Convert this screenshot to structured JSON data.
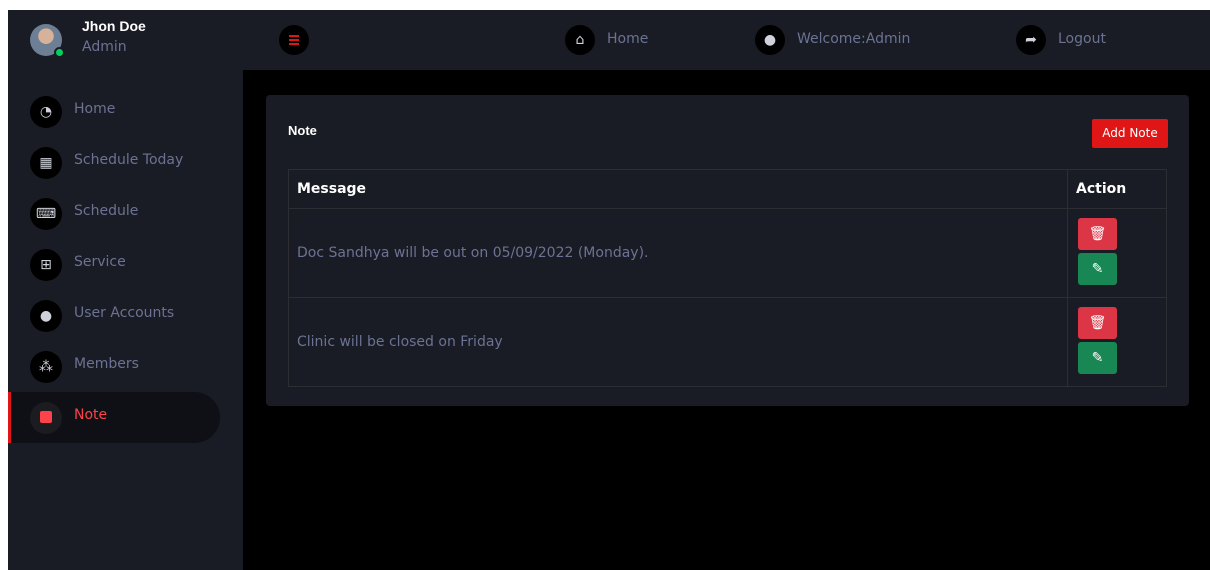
{
  "profile": {
    "name": "Jhon Doe",
    "role": "Admin"
  },
  "sidebar": {
    "items": [
      {
        "label": "Home",
        "icon": "dashboard-icon",
        "glyph": "◔",
        "active": false
      },
      {
        "label": "Schedule Today",
        "icon": "grid-icon",
        "glyph": "▦",
        "active": false
      },
      {
        "label": "Schedule",
        "icon": "keyboard-icon",
        "glyph": "⌨",
        "active": false
      },
      {
        "label": "Service",
        "icon": "table-icon",
        "glyph": "⊞",
        "active": false
      },
      {
        "label": "User Accounts",
        "icon": "user-icon",
        "glyph": "●",
        "active": false
      },
      {
        "label": "Members",
        "icon": "users-icon",
        "glyph": "⁂",
        "active": false
      },
      {
        "label": "Note",
        "icon": "sticky-note-icon",
        "glyph": "",
        "active": true
      }
    ]
  },
  "topbar": {
    "home": {
      "label": "Home",
      "glyph": "⌂"
    },
    "welcome": {
      "label": "Welcome:Admin",
      "glyph": "●"
    },
    "logout": {
      "label": "Logout",
      "glyph": "➦"
    }
  },
  "card": {
    "title": "Note",
    "add_button": "Add Note",
    "columns": {
      "message": "Message",
      "action": "Action"
    },
    "rows": [
      {
        "message": "Doc Sandhya will be out on 05/09/2022 (Monday)."
      },
      {
        "message": "Clinic will be closed on Friday"
      }
    ]
  },
  "colors": {
    "accent": "#e01515",
    "delete": "#dc3545",
    "edit": "#198754",
    "sidebar_bg": "#191c24",
    "page_bg": "#000000"
  }
}
